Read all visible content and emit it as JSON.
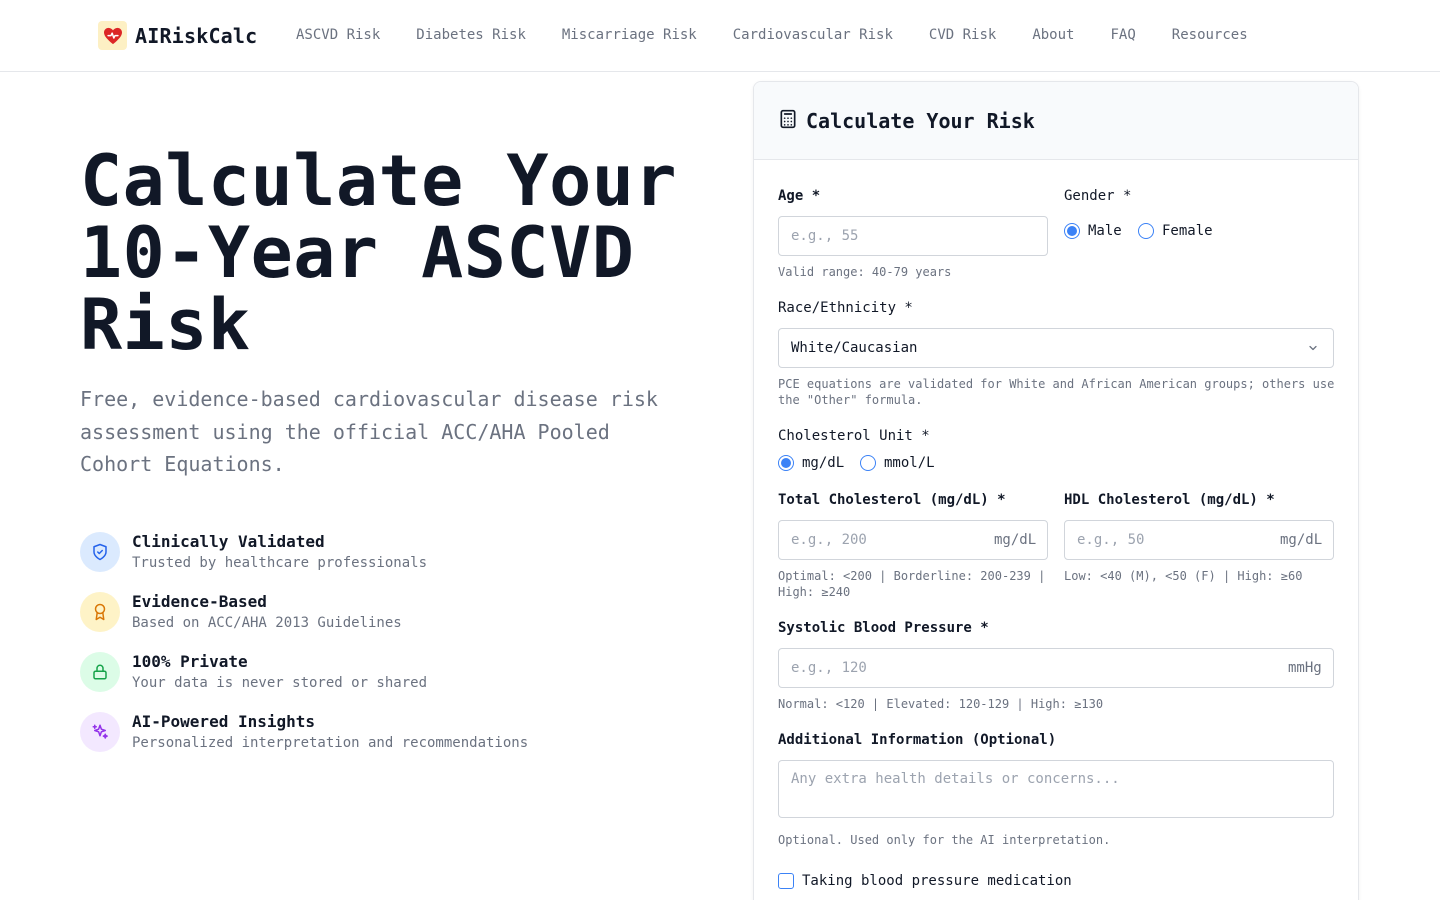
{
  "brand": {
    "name": "AIRiskCalc",
    "logo_icon": "heart-icon"
  },
  "nav": [
    "ASCVD Risk",
    "Diabetes Risk",
    "Miscarriage Risk",
    "Cardiovascular Risk",
    "CVD Risk",
    "About",
    "FAQ",
    "Resources"
  ],
  "hero": {
    "title": "Calculate Your 10-Year ASCVD Risk",
    "subtitle": "Free, evidence-based cardiovascular disease risk assessment using the official ACC/AHA Pooled Cohort Equations."
  },
  "features": [
    {
      "title": "Clinically Validated",
      "desc": "Trusted by healthcare professionals",
      "icon": "shield-check-icon",
      "color": "#2563eb",
      "bg": "#dbeafe"
    },
    {
      "title": "Evidence-Based",
      "desc": "Based on ACC/AHA 2013 Guidelines",
      "icon": "award-icon",
      "color": "#d97706",
      "bg": "#fef3c7"
    },
    {
      "title": "100% Private",
      "desc": "Your data is never stored or shared",
      "icon": "lock-icon",
      "color": "#16a34a",
      "bg": "#dcfce7"
    },
    {
      "title": "AI-Powered Insights",
      "desc": "Personalized interpretation and recommendations",
      "icon": "sparkles-icon",
      "color": "#9333ea",
      "bg": "#f3e8ff"
    }
  ],
  "form": {
    "title": "Calculate Your Risk",
    "age": {
      "label": "Age *",
      "placeholder": "e.g., 55",
      "hint": "Valid range: 40-79 years"
    },
    "gender": {
      "label": "Gender *",
      "options": [
        "Male",
        "Female"
      ],
      "selected": "Male"
    },
    "race": {
      "label": "Race/Ethnicity *",
      "value": "White/Caucasian",
      "hint": "PCE equations are validated for White and African American groups; others use the \"Other\" formula."
    },
    "chol_unit": {
      "label": "Cholesterol Unit *",
      "options": [
        "mg/dL",
        "mmol/L"
      ],
      "selected": "mg/dL"
    },
    "total_chol": {
      "label": "Total Cholesterol (mg/dL) *",
      "placeholder": "e.g., 200",
      "unit": "mg/dL",
      "hint": "Optimal: <200 | Borderline: 200-239 | High: ≥240"
    },
    "hdl_chol": {
      "label": "HDL Cholesterol (mg/dL) *",
      "placeholder": "e.g., 50",
      "unit": "mg/dL",
      "hint": "Low: <40 (M), <50 (F) | High: ≥60"
    },
    "sbp": {
      "label": "Systolic Blood Pressure *",
      "placeholder": "e.g., 120",
      "unit": "mmHg",
      "hint": "Normal: <120 | Elevated: 120-129 | High: ≥130"
    },
    "additional": {
      "label": "Additional Information (Optional)",
      "placeholder": "Any extra health details or concerns...",
      "hint": "Optional. Used only for the AI interpretation."
    },
    "bp_med": {
      "label": "Taking blood pressure medication",
      "checked": false
    }
  },
  "colors": {
    "accent": "#3b82f6",
    "text": "#111827",
    "muted": "#6b7280",
    "border": "#e5e7eb"
  }
}
